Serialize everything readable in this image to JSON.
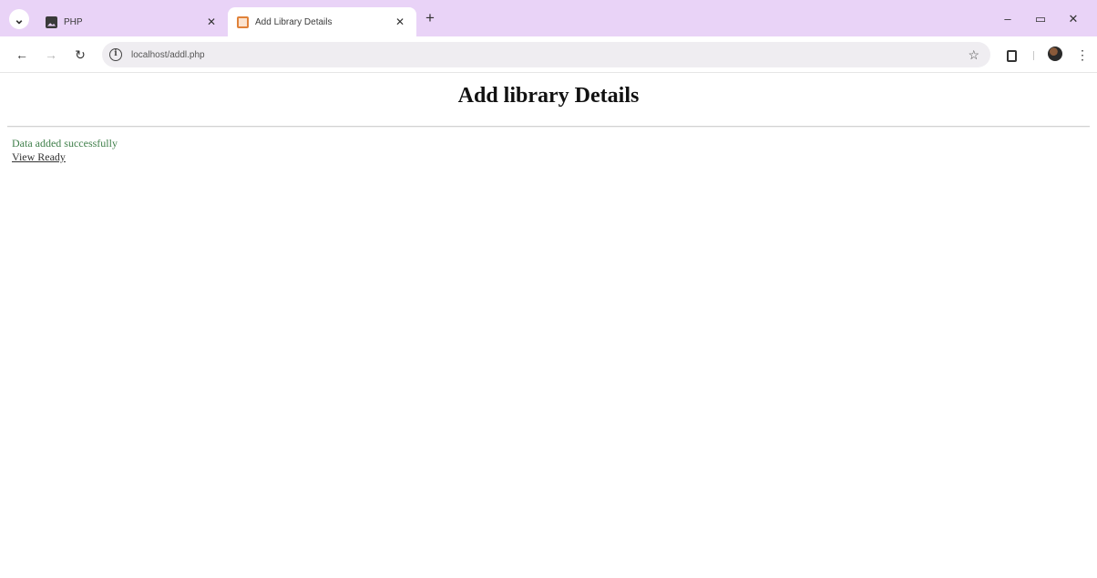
{
  "browser": {
    "tabs": [
      {
        "title": "PHP",
        "favicon": "image-icon",
        "active": false
      },
      {
        "title": "Add Library Details",
        "favicon": "page-icon",
        "active": true
      }
    ],
    "url": "localhost/addl.php",
    "window_controls": {
      "minimize": "–",
      "restore": "▭",
      "close": "✕"
    },
    "colors": {
      "tabstrip": "#e9d3f7",
      "omnibox": "#efedf1"
    }
  },
  "page": {
    "title": "Add library Details",
    "message": "Data added successfully",
    "link_label": "View Ready"
  }
}
